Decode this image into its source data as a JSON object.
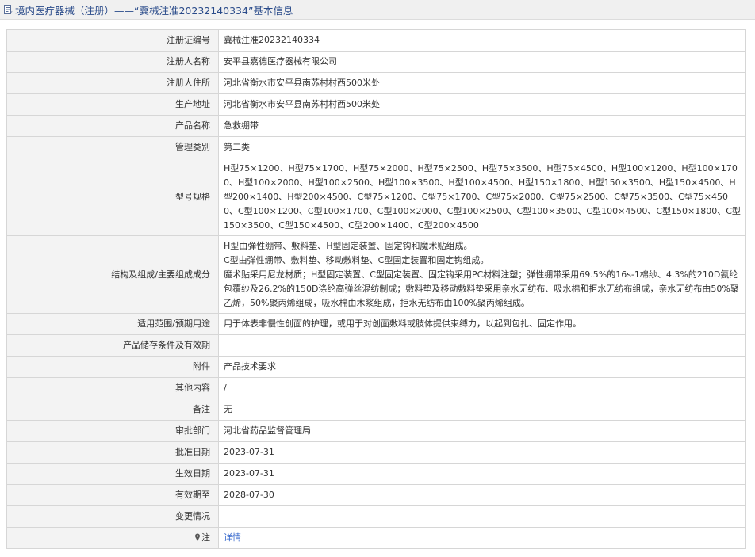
{
  "header": {
    "title": "境内医疗器械（注册）——“冀械注准20232140334”基本信息"
  },
  "rows": [
    {
      "label": "注册证编号",
      "value": "冀械注准20232140334"
    },
    {
      "label": "注册人名称",
      "value": "安平县嘉德医疗器械有限公司"
    },
    {
      "label": "注册人住所",
      "value": "河北省衡水市安平县南苏村村西500米处"
    },
    {
      "label": "生产地址",
      "value": "河北省衡水市安平县南苏村村西500米处"
    },
    {
      "label": "产品名称",
      "value": "急救绷带"
    },
    {
      "label": "管理类别",
      "value": "第二类"
    },
    {
      "label": "型号规格",
      "value": "H型75×1200、H型75×1700、H型75×2000、H型75×2500、H型75×3500、H型75×4500、H型100×1200、H型100×1700、H型100×2000、H型100×2500、H型100×3500、H型100×4500、H型150×1800、H型150×3500、H型150×4500、H型200×1400、H型200×4500、C型75×1200、C型75×1700、C型75×2000、C型75×2500、C型75×3500、C型75×4500、C型100×1200、C型100×1700、C型100×2000、C型100×2500、C型100×3500、C型100×4500、C型150×1800、C型150×3500、C型150×4500、C型200×1400、C型200×4500"
    },
    {
      "label": "结构及组成/主要组成成分",
      "lines": [
        "H型由弹性绷带、敷料垫、H型固定装置、固定钩和魔术贴组成。",
        "C型由弹性绷带、敷料垫、移动敷料垫、C型固定装置和固定钩组成。",
        "魔术贴采用尼龙材质；H型固定装置、C型固定装置、固定钩采用PC材料注塑；弹性绷带采用69.5%的16s-1棉纱、4.3%的210D氨纶包覆纱及26.2%的150D涤纶高弹丝混纺制成；敷料垫及移动敷料垫采用亲水无纺布、吸水棉和拒水无纺布组成，亲水无纺布由50%聚乙烯，50%聚丙烯组成，吸水棉由木浆组成，拒水无纺布由100%聚丙烯组成。"
      ]
    },
    {
      "label": "适用范围/预期用途",
      "value": "用于体表非慢性创面的护理，或用于对创面敷料或肢体提供束缚力，以起到包扎、固定作用。"
    },
    {
      "label": "产品储存条件及有效期",
      "value": ""
    },
    {
      "label": "附件",
      "value": "产品技术要求"
    },
    {
      "label": "其他内容",
      "value": "/"
    },
    {
      "label": "备注",
      "value": "无"
    },
    {
      "label": "审批部门",
      "value": "河北省药品监督管理局"
    },
    {
      "label": "批准日期",
      "value": "2023-07-31"
    },
    {
      "label": "生效日期",
      "value": "2023-07-31"
    },
    {
      "label": "有效期至",
      "value": "2028-07-30"
    },
    {
      "label": "变更情况",
      "value": ""
    },
    {
      "label": "注",
      "value": "详情"
    }
  ],
  "icons": {
    "header_icon": "document-icon",
    "note_icon": "map-pin-icon"
  },
  "colors": {
    "header_text": "#2a4b8a",
    "link": "#3366cc",
    "label_bg": "#f3f3f3",
    "border": "#d6d6d6"
  }
}
